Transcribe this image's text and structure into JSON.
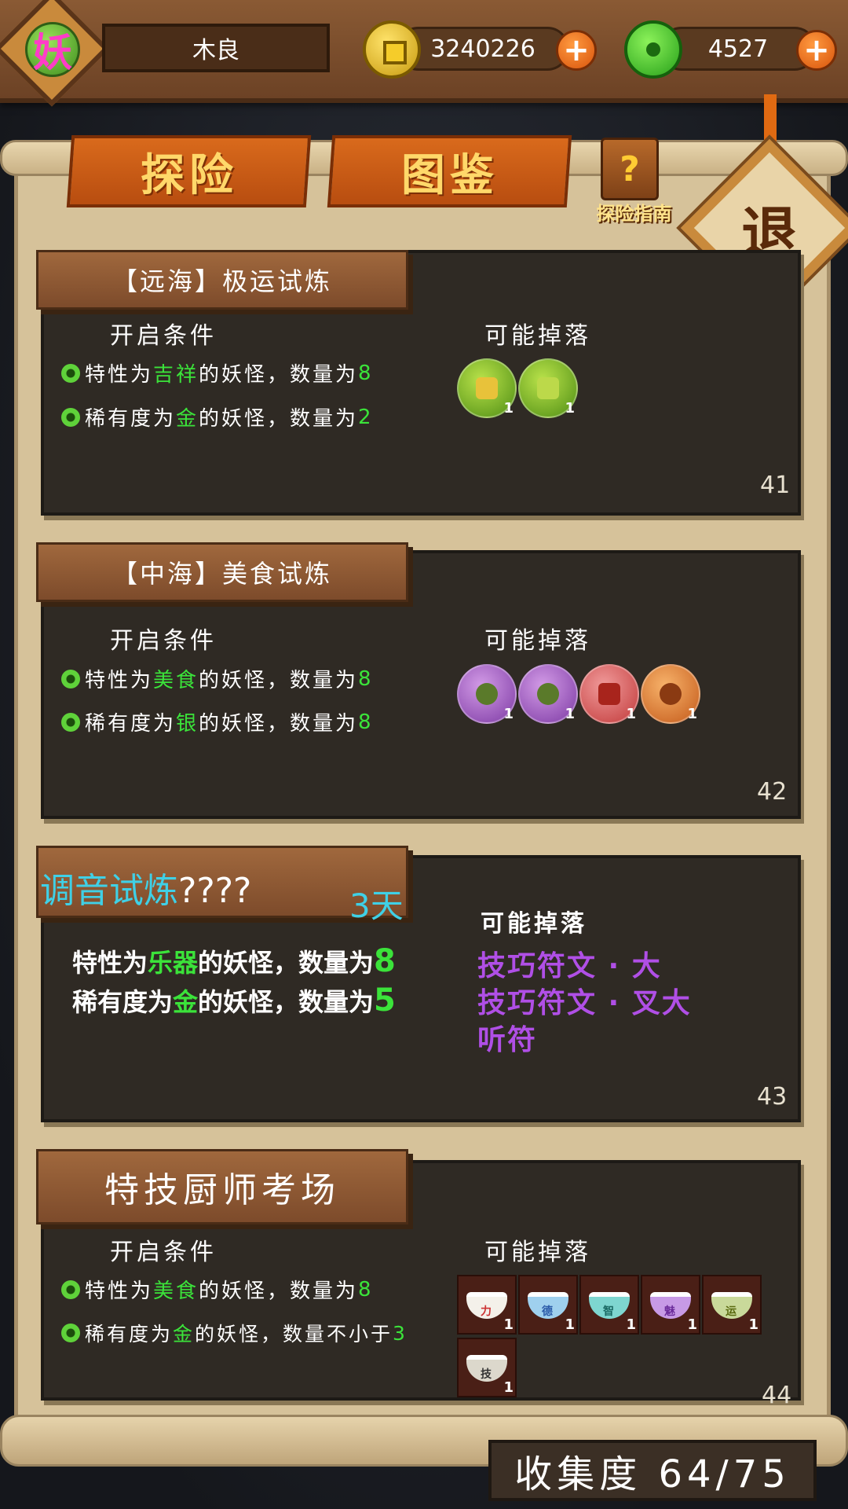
{
  "header": {
    "avatar_char": "妖",
    "player_name": "木良",
    "gold_amount": "3240226",
    "jade_amount": "4527",
    "plus": "+"
  },
  "tabs": [
    {
      "label": "探险"
    },
    {
      "label": "图鉴"
    }
  ],
  "guide": {
    "icon": "?",
    "label": "探险指南"
  },
  "exit": {
    "label": "退"
  },
  "cards": [
    {
      "title": "【远海】极运试炼",
      "cond_label": "开启条件",
      "drop_label": "可能掉落",
      "cond1": {
        "pre": "特性为",
        "hl": "吉祥",
        "post": "的妖怪，数量为",
        "num": "8"
      },
      "cond2": {
        "pre": "稀有度为",
        "hl": "金",
        "post": "的妖怪，数量为",
        "num": "2"
      },
      "items": [
        {
          "icon": "lucky-dice-orb-icon",
          "count": "1"
        },
        {
          "icon": "lucky-dice-orb-icon",
          "count": "1"
        }
      ],
      "number": "41"
    },
    {
      "title": "【中海】美食试炼",
      "cond_label": "开启条件",
      "drop_label": "可能掉落",
      "cond1": {
        "pre": "特性为",
        "hl": "美食",
        "post": "的妖怪，数量为",
        "num": "8"
      },
      "cond2": {
        "pre": "稀有度为",
        "hl": "银",
        "post": "的妖怪，数量为",
        "num": "8"
      },
      "items": [
        {
          "icon": "feather-orb-icon",
          "count": "1"
        },
        {
          "icon": "feather-orb-icon",
          "count": "1"
        },
        {
          "icon": "meat-orb-icon",
          "count": "1"
        },
        {
          "icon": "drumstick-orb-icon",
          "count": "1"
        }
      ],
      "number": "42"
    },
    {
      "title": "调音试炼",
      "title_suffix": "????",
      "days": "3天",
      "drop_label": "可能掉落",
      "cond1": {
        "pre": "特性为",
        "hl": "乐器",
        "post": "的妖怪，数量为",
        "num": "8"
      },
      "cond2": {
        "pre": "稀有度为",
        "hl": "金",
        "post": "的妖怪，数量为",
        "num": "5"
      },
      "drops": [
        "技巧符文 · 大",
        "技巧符文 · 叉大",
        "听符"
      ],
      "number": "43"
    },
    {
      "title": "特技厨师考场",
      "cond_label": "开启条件",
      "drop_label": "可能掉落",
      "cond1": {
        "pre": "特性为",
        "hl": "美食",
        "post": "的妖怪，数量为",
        "num": "8"
      },
      "cond2": {
        "pre": "稀有度为",
        "hl": "金",
        "post": "的妖怪，数量不小于",
        "num": "3"
      },
      "bowls": [
        {
          "tag": "力",
          "count": "1"
        },
        {
          "tag": "德",
          "count": "1"
        },
        {
          "tag": "智",
          "count": "1"
        },
        {
          "tag": "魅",
          "count": "1"
        },
        {
          "tag": "运",
          "count": "1"
        },
        {
          "tag": "技",
          "count": "1"
        }
      ],
      "number": "44"
    }
  ],
  "footer": {
    "collection": "收集度  64/75"
  }
}
